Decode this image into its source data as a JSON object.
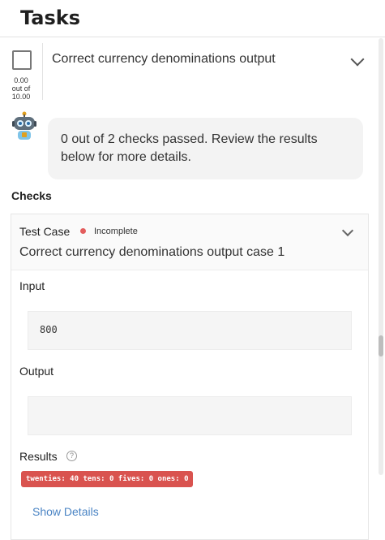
{
  "header": {
    "title": "Tasks"
  },
  "task": {
    "title": "Correct currency denominations output",
    "score_lines": [
      "0.00",
      "out of",
      "10.00"
    ]
  },
  "summary": "0 out of 2 checks passed. Review the results below for more details.",
  "checks": {
    "label": "Checks",
    "test_case": {
      "label": "Test Case",
      "status": "Incomplete",
      "status_color": "#e35d5d",
      "title": "Correct currency denominations output case 1",
      "input_label": "Input",
      "input_value": "800",
      "output_label": "Output",
      "output_value": "",
      "results_label": "Results",
      "result_badge": "twenties: 40 tens: 0 fives: 0 ones: 0",
      "result_badge_color": "#d9534f",
      "show_details": "Show Details"
    }
  }
}
